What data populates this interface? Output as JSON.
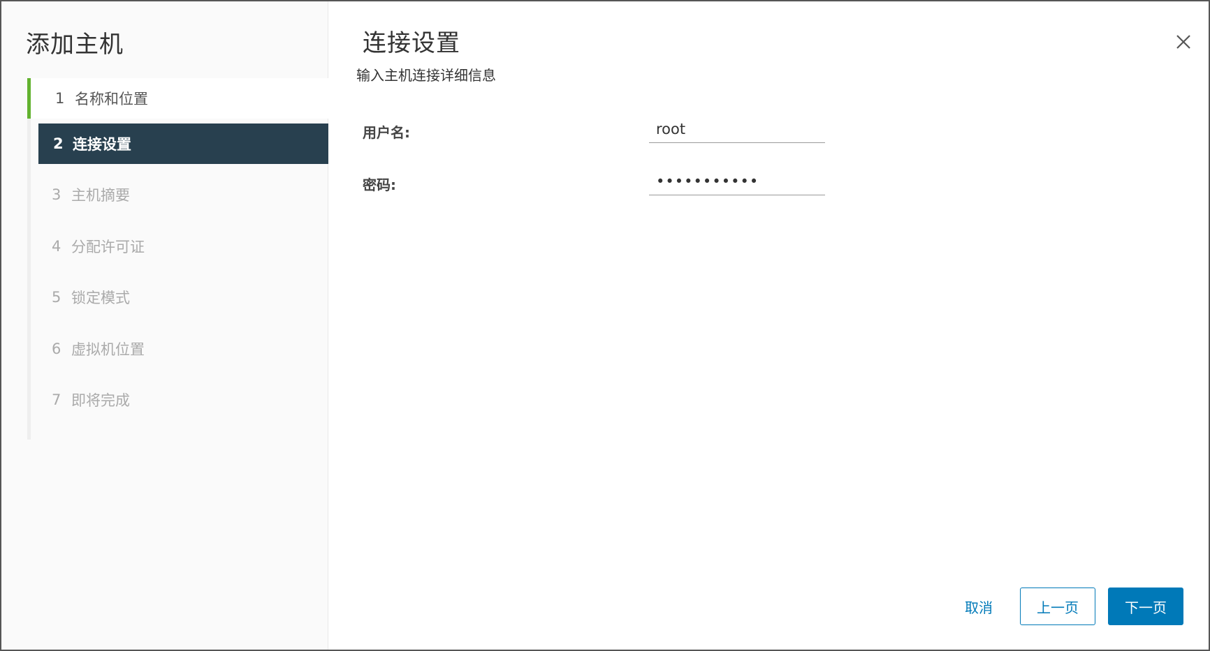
{
  "wizard": {
    "title": "添加主机",
    "steps": [
      {
        "num": "1",
        "label": "名称和位置",
        "state": "done"
      },
      {
        "num": "2",
        "label": "连接设置",
        "state": "active"
      },
      {
        "num": "3",
        "label": "主机摘要",
        "state": "pending"
      },
      {
        "num": "4",
        "label": "分配许可证",
        "state": "pending"
      },
      {
        "num": "5",
        "label": "锁定模式",
        "state": "pending"
      },
      {
        "num": "6",
        "label": "虚拟机位置",
        "state": "pending"
      },
      {
        "num": "7",
        "label": "即将完成",
        "state": "pending"
      }
    ]
  },
  "page": {
    "title": "连接设置",
    "subtitle": "输入主机连接详细信息",
    "close_icon": "close-icon"
  },
  "form": {
    "username_label": "用户名:",
    "username_value": "root",
    "password_label": "密码:",
    "password_value": "•••••••••••"
  },
  "footer": {
    "cancel_label": "取消",
    "back_label": "上一页",
    "next_label": "下一页"
  },
  "colors": {
    "active_step_bg": "#28404f",
    "done_indicator": "#62b22f",
    "primary": "#0079b8"
  }
}
